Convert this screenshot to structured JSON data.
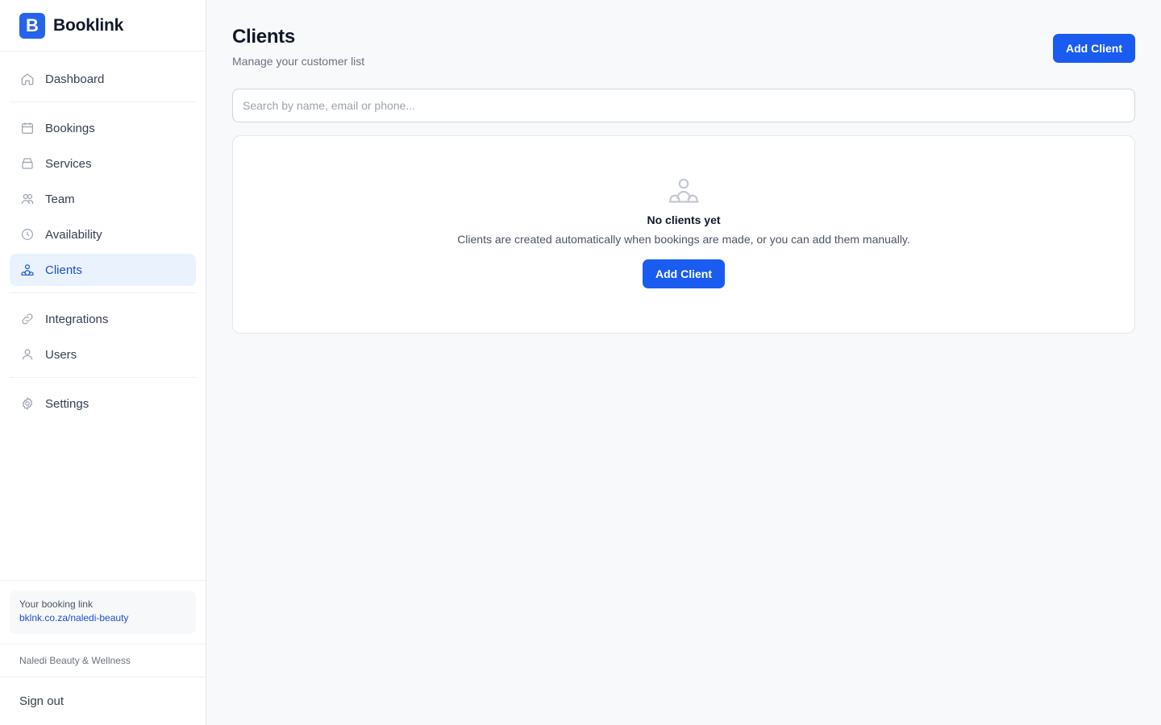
{
  "brand": {
    "logo_letter": "B",
    "name": "Booklink",
    "color": "#2563eb"
  },
  "sidebar": {
    "items": [
      {
        "label": "Dashboard",
        "icon": "home-icon"
      },
      {
        "label": "Bookings",
        "icon": "calendar-icon"
      },
      {
        "label": "Services",
        "icon": "services-icon"
      },
      {
        "label": "Team",
        "icon": "team-icon"
      },
      {
        "label": "Availability",
        "icon": "clock-icon"
      },
      {
        "label": "Clients",
        "icon": "clients-icon",
        "active": true
      },
      {
        "label": "Integrations",
        "icon": "link-icon"
      },
      {
        "label": "Users",
        "icon": "user-icon"
      },
      {
        "label": "Settings",
        "icon": "gear-icon"
      }
    ],
    "booking_link_label": "Your booking link",
    "booking_link_url": "bklnk.co.za/naledi-beauty",
    "business_name": "Naledi Beauty & Wellness",
    "sign_out": "Sign out"
  },
  "main": {
    "title": "Clients",
    "subtitle": "Manage your customer list",
    "add_button": "Add Client",
    "search_placeholder": "Search by name, email or phone...",
    "empty": {
      "icon": "clients-icon",
      "title": "No clients yet",
      "description": "Clients are created automatically when bookings are made, or you can add them manually.",
      "button": "Add Client"
    }
  },
  "colors": {
    "accent": "#1a5cf0",
    "active_bg": "#eaf2fe",
    "active_text": "#1e4fbf"
  }
}
